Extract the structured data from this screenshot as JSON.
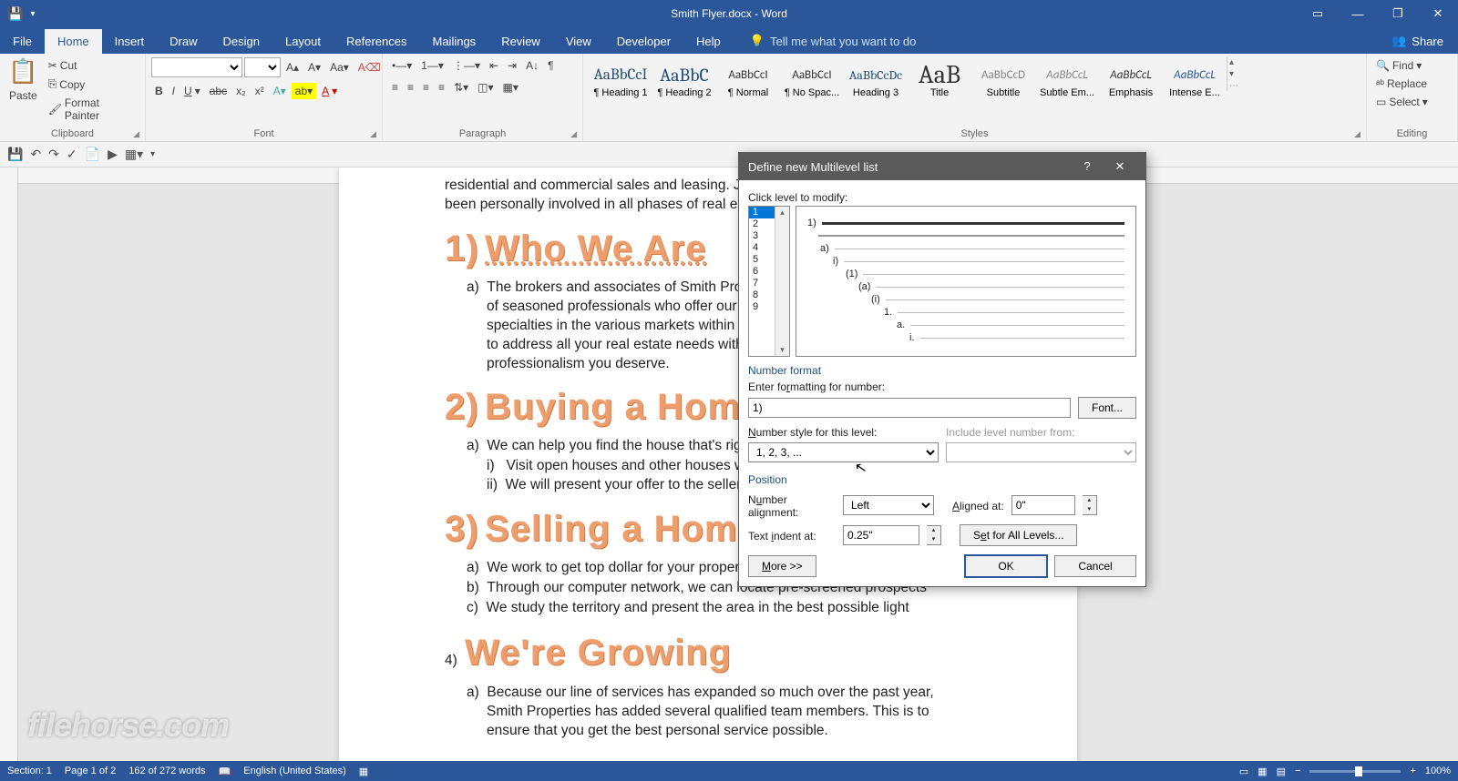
{
  "title": "Smith Flyer.docx - Word",
  "tabs": [
    "File",
    "Home",
    "Insert",
    "Draw",
    "Design",
    "Layout",
    "References",
    "Mailings",
    "Review",
    "View",
    "Developer",
    "Help"
  ],
  "tellme": "Tell me what you want to do",
  "share": "Share",
  "clipboard": {
    "paste": "Paste",
    "cut": "Cut",
    "copy": "Copy",
    "fp": "Format Painter",
    "label": "Clipboard"
  },
  "font": {
    "label": "Font"
  },
  "para": {
    "label": "Paragraph"
  },
  "styles": {
    "label": "Styles",
    "items": [
      {
        "preview": "AaBbCcI",
        "name": "¶ Heading 1"
      },
      {
        "preview": "AaBbC",
        "name": "¶ Heading 2"
      },
      {
        "preview": "AaBbCcI",
        "name": "¶ Normal"
      },
      {
        "preview": "AaBbCcI",
        "name": "¶ No Spac..."
      },
      {
        "preview": "AaBbCcDc",
        "name": "Heading 3"
      },
      {
        "preview": "AaB",
        "name": "Title"
      },
      {
        "preview": "AaBbCcD",
        "name": "Subtitle"
      },
      {
        "preview": "AaBbCcL",
        "name": "Subtle Em..."
      },
      {
        "preview": "AaBbCcL",
        "name": "Emphasis"
      },
      {
        "preview": "AaBbCcL",
        "name": "Intense E..."
      }
    ]
  },
  "editing": {
    "label": "Editing",
    "find": "Find",
    "replace": "Replace",
    "select": "Select"
  },
  "doc": {
    "intro": "residential and commercial sales and leasing. Jan Sm\nbeen personally involved in all phases of real estate f",
    "h1": {
      "num": "1)",
      "text": "Who We Are"
    },
    "p1a": "The brokers and associates of Smith Properties\nof seasoned professionals who offer our client\nspecialties in the various markets within the a\nto address all your real estate needs with the c\nprofessionalism you deserve.",
    "h2": {
      "num": "2)",
      "text": "Buying a Hom"
    },
    "p2a": "We can help you find the house that's right fo",
    "p2i": "Visit open houses and other houses with y",
    "p2ii": "We will present your offer to the sellers",
    "h3": {
      "num": "3)",
      "text": "Selling a Hom"
    },
    "p3a": "We work to get top dollar for your property",
    "p3b": "Through our computer network, we can locate pre-screened prospects",
    "p3c": "We study the territory and present the area in the best possible light",
    "h4": {
      "num": "4)",
      "text": "We're Growing"
    },
    "p4a": "Because our line of services has expanded so much over the past year, Smith Properties has added several qualified team members. This is to ensure that you get the best personal service possible."
  },
  "dialog": {
    "title": "Define new Multilevel list",
    "clicklevel": "Click level to modify:",
    "levels": [
      "1",
      "2",
      "3",
      "4",
      "5",
      "6",
      "7",
      "8",
      "9"
    ],
    "previewLabels": [
      "1)",
      "a)",
      "i)",
      "(1)",
      "(a)",
      "(i)",
      "1.",
      "a.",
      "i."
    ],
    "numfmt": "Number format",
    "enterfmt": "Enter formatting for number:",
    "fmtval": "1)",
    "font": "Font...",
    "numstyle": "Number style for this level:",
    "numstyleval": "1, 2, 3, ...",
    "include": "Include level number from:",
    "position": "Position",
    "numalign": "Number alignment:",
    "numalignval": "Left",
    "aligned": "Aligned at:",
    "alignedval": "0\"",
    "indent": "Text indent at:",
    "indentval": "0.25\"",
    "setall": "Set for All Levels...",
    "more": "More >>",
    "ok": "OK",
    "cancel": "Cancel"
  },
  "status": {
    "section": "Section: 1",
    "page": "Page 1 of 2",
    "words": "162 of 272 words",
    "lang": "English (United States)",
    "zoom": "100%"
  },
  "watermark": "filehorse.com"
}
